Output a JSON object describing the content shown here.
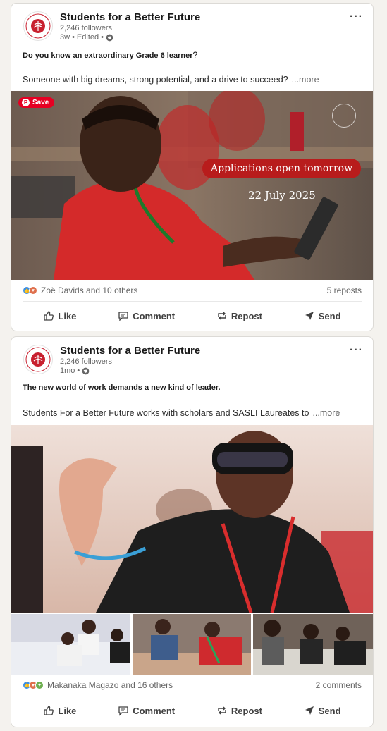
{
  "posts": [
    {
      "org_name": "Students for a Better Future",
      "followers": "2,246 followers",
      "time": "3w",
      "edited": "Edited",
      "headline": "Do you know an extraordinary Grade 6 learner",
      "headline_tail": "?",
      "body": "Someone with big dreams, strong potential, and a drive to succeed?",
      "more": "...more",
      "image": {
        "save_label": "Save",
        "banner": "Applications open tomorrow",
        "date": "22 July 2025"
      },
      "reactions_text": "Zoë Davids and 10 others",
      "right_count": "5 reposts"
    },
    {
      "org_name": "Students for a Better Future",
      "followers": "2,246 followers",
      "time": "1mo",
      "headline": "The new world of work demands a new kind of leader.",
      "body": "Students For a Better Future works with scholars and SASLI Laureates to",
      "more": "...more",
      "reactions_text": "Makanaka Magazo and 16 others",
      "right_count": "2 comments"
    }
  ],
  "actions": {
    "like": "Like",
    "comment": "Comment",
    "repost": "Repost",
    "send": "Send"
  },
  "icons": [
    "logo-icon",
    "globe-icon",
    "more-icon",
    "like-icon",
    "comment-icon",
    "repost-icon",
    "send-icon",
    "pinterest-icon"
  ],
  "colors": {
    "brand_red": "#c8202f",
    "background": "#f4f2ee",
    "pinterest": "#e60023"
  }
}
